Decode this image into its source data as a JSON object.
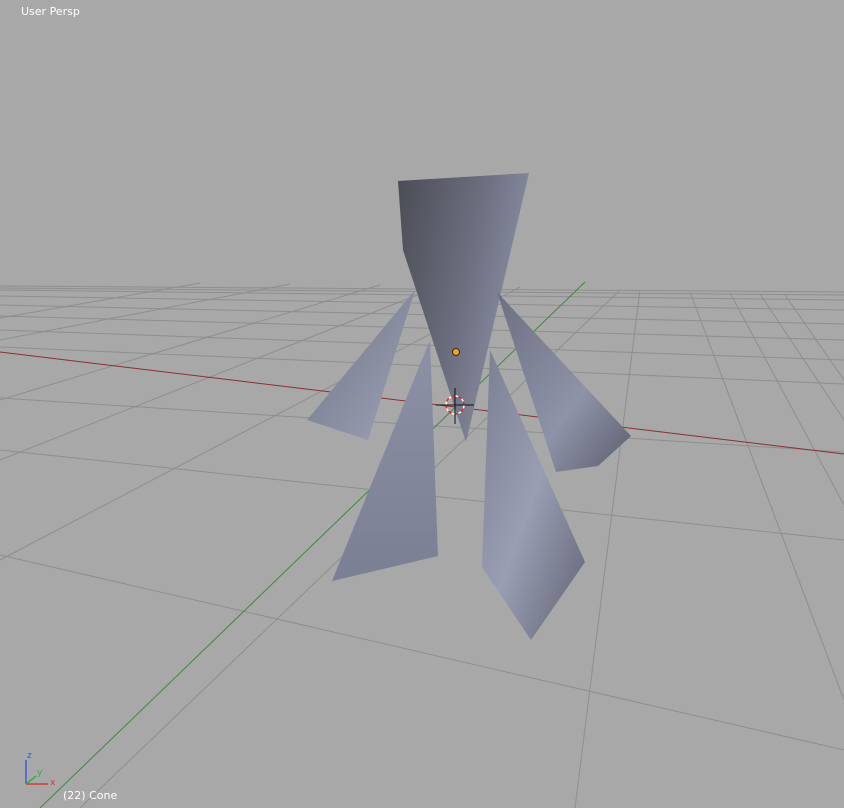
{
  "viewport": {
    "view_label": "User Persp",
    "object_label": "(22) Cone",
    "background_color": "#a8a8a8",
    "grid_color": "#8e8e8e",
    "x_axis_color": "#8c2f2f",
    "y_axis_color": "#3d8a3d",
    "mesh_color": "#8f93a6"
  },
  "axis_gizmo": {
    "x_label": "x",
    "y_label": "y",
    "z_label": "z",
    "x_color": "#d23a3a",
    "y_color": "#3aa83a",
    "z_color": "#3a5fd2"
  },
  "icons": {
    "origin": "origin-dot-icon",
    "cursor": "3d-cursor-icon",
    "gizmo": "axis-gizmo-icon"
  }
}
